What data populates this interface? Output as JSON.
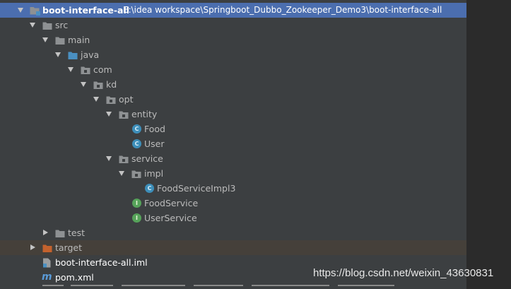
{
  "project": {
    "name": "boot-interface-all",
    "path": "E:\\idea workspace\\Springboot_Dubbo_Zookeeper_Demo3\\boot-interface-all"
  },
  "tree": {
    "src": "src",
    "main": "main",
    "java": "java",
    "com": "com",
    "kd": "kd",
    "opt": "opt",
    "entity": "entity",
    "food": "Food",
    "user": "User",
    "service": "service",
    "impl": "impl",
    "food_service_impl3": "FoodServiceImpl3",
    "food_service": "FoodService",
    "user_service": "UserService",
    "test": "test",
    "target": "target",
    "iml_file": "boot-interface-all.iml",
    "pom_file": "pom.xml"
  },
  "icon_glyphs": {
    "class": "C",
    "interface": "I",
    "maven": "m"
  },
  "watermark": "https://blog.csdn.net/weixin_43630831",
  "colors": {
    "panel_bg": "#3c3f41",
    "selection": "#4b6eaf",
    "excluded_row": "#45403a",
    "folder": "#8e9193",
    "source_folder": "#4a90c2",
    "excluded_folder": "#c4622d",
    "class_icon": "#3d8eb9",
    "interface_icon": "#56a35a"
  }
}
